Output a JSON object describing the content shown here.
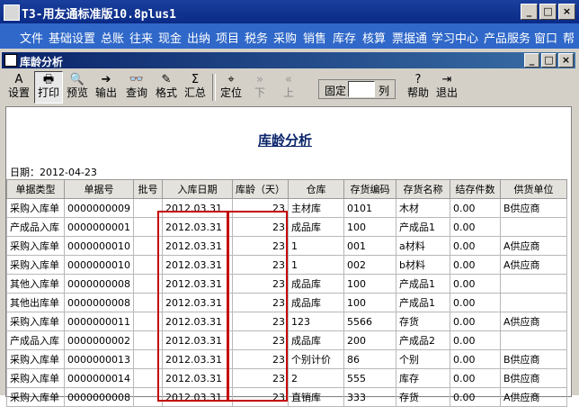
{
  "window": {
    "title": "T3-用友通标准版10.8plus1",
    "buttons": [
      "_",
      "□",
      "×"
    ]
  },
  "menu": [
    "文件",
    "基础设置",
    "总账",
    "往来",
    "现金",
    "出纳",
    "项目",
    "税务",
    "采购",
    "销售",
    "库存",
    "核算",
    "票据通",
    "学习中心",
    "产品服务",
    "窗口",
    "帮"
  ],
  "child": {
    "title": "库龄分析",
    "buttons": [
      "_",
      "□",
      "×"
    ]
  },
  "toolbar": {
    "buttons": [
      {
        "label": "设置",
        "icon": "A"
      },
      {
        "label": "打印",
        "icon": "🖶"
      },
      {
        "label": "预览",
        "icon": "🔍"
      },
      {
        "label": "输出",
        "icon": "➔"
      },
      {
        "label": "查询",
        "icon": "👓"
      },
      {
        "label": "格式",
        "icon": "✎"
      },
      {
        "label": "汇总",
        "icon": "Σ"
      },
      {
        "label": "定位",
        "icon": "⌖"
      },
      {
        "label": "下",
        "icon": "»"
      },
      {
        "label": "上",
        "icon": "«"
      },
      {
        "label": "帮助",
        "icon": "?"
      },
      {
        "label": "退出",
        "icon": "⇥"
      }
    ],
    "fixed_label": "固定",
    "fixed_value": "",
    "column_label": "列"
  },
  "report": {
    "title": "库龄分析",
    "date_label": "日期：2012-04-23",
    "columns": [
      "单据类型",
      "单据号",
      "批号",
      "入库日期",
      "库龄（天）",
      "仓库",
      "存货编码",
      "存货名称",
      "结存件数",
      "供货单位"
    ],
    "rows": [
      [
        "采购入库单",
        "0000000009",
        "",
        "2012.03.31",
        "23",
        "主材库",
        "0101",
        "木材",
        "0.00",
        "B供应商"
      ],
      [
        "产成品入库",
        "0000000001",
        "",
        "2012.03.31",
        "23",
        "成品库",
        "100",
        "产成品1",
        "0.00",
        ""
      ],
      [
        "采购入库单",
        "0000000010",
        "",
        "2012.03.31",
        "23",
        "1",
        "001",
        "a材料",
        "0.00",
        "A供应商"
      ],
      [
        "采购入库单",
        "0000000010",
        "",
        "2012.03.31",
        "23",
        "1",
        "002",
        "b材料",
        "0.00",
        "A供应商"
      ],
      [
        "其他入库单",
        "0000000008",
        "",
        "2012.03.31",
        "23",
        "成品库",
        "100",
        "产成品1",
        "0.00",
        ""
      ],
      [
        "其他出库单",
        "0000000008",
        "",
        "2012.03.31",
        "23",
        "成品库",
        "100",
        "产成品1",
        "0.00",
        ""
      ],
      [
        "采购入库单",
        "0000000011",
        "",
        "2012.03.31",
        "23",
        "123",
        "5566",
        "存货",
        "0.00",
        "A供应商"
      ],
      [
        "产成品入库",
        "0000000002",
        "",
        "2012.03.31",
        "23",
        "成品库",
        "200",
        "产成品2",
        "0.00",
        ""
      ],
      [
        "采购入库单",
        "0000000013",
        "",
        "2012.03.31",
        "23",
        "个别计价",
        "86",
        "个别",
        "0.00",
        "B供应商"
      ],
      [
        "采购入库单",
        "0000000014",
        "",
        "2012.03.31",
        "23",
        "2",
        "555",
        "库存",
        "0.00",
        "B供应商"
      ],
      [
        "采购入库单",
        "0000000008",
        "",
        "2012.03.31",
        "23",
        "直销库",
        "333",
        "存货",
        "0.00",
        "A供应商"
      ]
    ]
  }
}
